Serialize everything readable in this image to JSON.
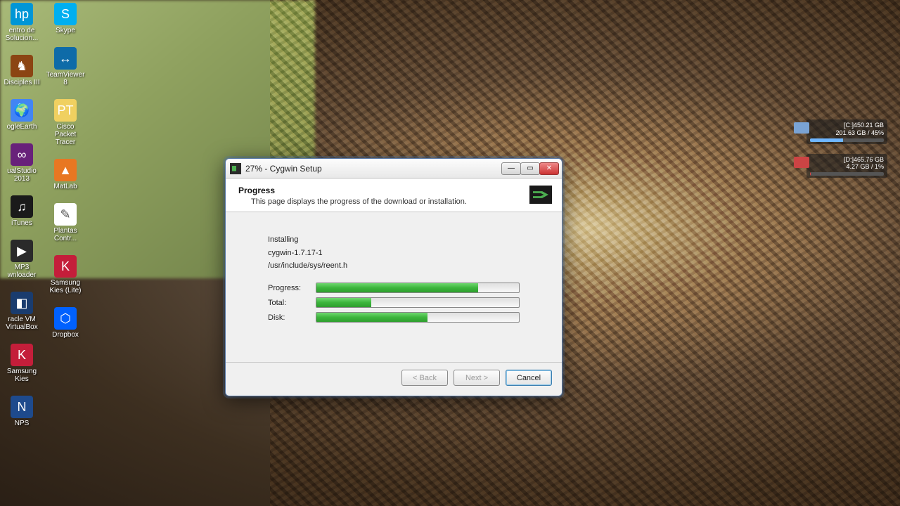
{
  "desktop_icons_col1": [
    {
      "label": "entro de Solucion...",
      "cls": "hp",
      "glyph": "hp"
    },
    {
      "label": "Disciples III",
      "cls": "disc",
      "glyph": "♞"
    },
    {
      "label": "ogleEarth",
      "cls": "earth",
      "glyph": "🌍"
    },
    {
      "label": "ualStudio 2013",
      "cls": "vs",
      "glyph": "∞"
    },
    {
      "label": "iTunes",
      "cls": "itunes",
      "glyph": "♫"
    },
    {
      "label": "MP3 wnloader",
      "cls": "mp3",
      "glyph": "▶"
    },
    {
      "label": "racle VM VirtualBox",
      "cls": "vbox",
      "glyph": "◧"
    },
    {
      "label": "Samsung Kies",
      "cls": "kies2",
      "glyph": "K"
    },
    {
      "label": "NPS",
      "cls": "nps",
      "glyph": "N"
    }
  ],
  "desktop_icons_col2": [
    {
      "label": "Skype",
      "cls": "skype",
      "glyph": "S"
    },
    {
      "label": "TeamViewer 8",
      "cls": "tv",
      "glyph": "↔"
    },
    {
      "label": "Cisco Packet Tracer",
      "cls": "cisco",
      "glyph": "PT"
    },
    {
      "label": "MatLab",
      "cls": "matlab",
      "glyph": "▲"
    },
    {
      "label": "Plantas Contr...",
      "cls": "plant",
      "glyph": "✎"
    },
    {
      "label": "Samsung Kies (Lite)",
      "cls": "kies",
      "glyph": "K"
    },
    {
      "label": "Dropbox",
      "cls": "dbox",
      "glyph": "⬡"
    }
  ],
  "drives": [
    {
      "line1": "[C:]450.21 GB",
      "line2": "201.63 GB / 45%",
      "pct": 45,
      "color": "#6fb6ff",
      "ico": ""
    },
    {
      "line1": "[D:]465.76 GB",
      "line2": "4.27 GB / 1%",
      "pct": 1,
      "color": "#e24444",
      "ico": "red"
    }
  ],
  "dialog": {
    "title": "27% - Cygwin Setup",
    "header_title": "Progress",
    "header_desc": "This page displays the progress of the download or installation.",
    "status": {
      "action": "Installing",
      "package": "cygwin-1.7.17-1",
      "file": "/usr/include/sys/reent.h"
    },
    "bars": {
      "progress_label": "Progress:",
      "progress_pct": 80,
      "total_label": "Total:",
      "total_pct": 27,
      "disk_label": "Disk:",
      "disk_pct": 55
    },
    "buttons": {
      "back": "< Back",
      "next": "Next >",
      "cancel": "Cancel"
    }
  }
}
